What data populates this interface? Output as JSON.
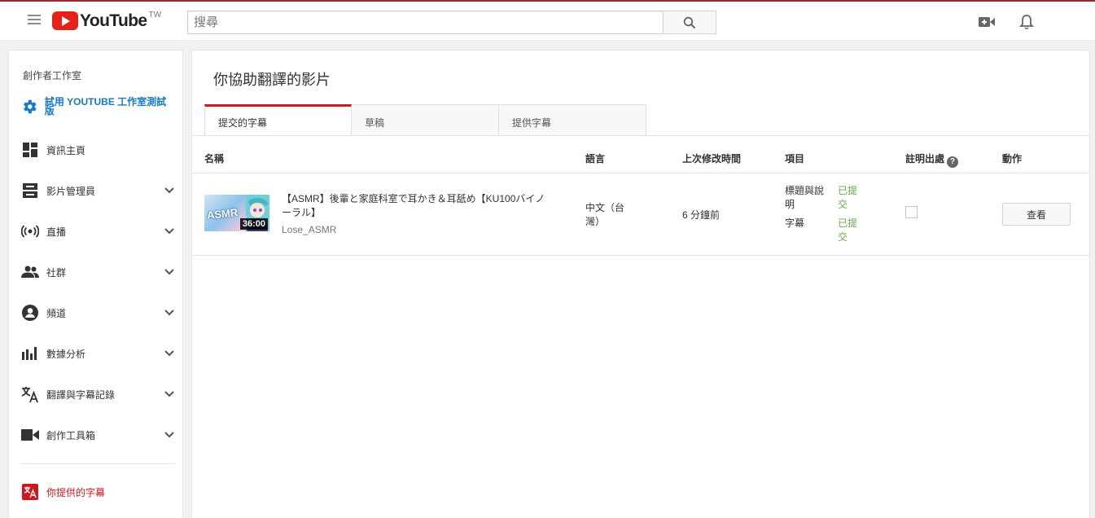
{
  "header": {
    "logo_text": "YouTube",
    "logo_region": "TW",
    "search_placeholder": "搜尋"
  },
  "sidebar": {
    "header": "創作者工作室",
    "try_studio": "試用 YOUTUBE 工作室測試版",
    "items": [
      {
        "label": "資訊主頁",
        "icon": "dashboard-icon"
      },
      {
        "label": "影片管理員",
        "icon": "video-manager-icon"
      },
      {
        "label": "直播",
        "icon": "live-icon"
      },
      {
        "label": "社群",
        "icon": "community-icon"
      },
      {
        "label": "頻道",
        "icon": "channel-icon"
      },
      {
        "label": "數據分析",
        "icon": "analytics-icon"
      },
      {
        "label": "翻譯與字幕記錄",
        "icon": "translate-icon"
      },
      {
        "label": "創作工具箱",
        "icon": "create-icon"
      }
    ],
    "contributions": "你提供的字幕"
  },
  "main": {
    "title": "你協助翻譯的影片",
    "tabs": [
      {
        "label": "提交的字幕",
        "active": true
      },
      {
        "label": "草稿",
        "active": false
      },
      {
        "label": "提供字幕",
        "active": false
      }
    ],
    "columns": {
      "name": "名稱",
      "language": "語言",
      "modified": "上次修改時間",
      "items": "項目",
      "credit": "註明出處",
      "action": "動作"
    },
    "rows": [
      {
        "thumb_text": "ASMR",
        "duration": "36:00",
        "title": "【ASMR】後輩と家庭科室で耳かき＆耳舐め【KU100バイノーラル】",
        "channel": "Lose_ASMR",
        "language": "中文（台灣）",
        "modified": "6 分鐘前",
        "item1_label": "標題與說明",
        "item1_status": "已提交",
        "item2_label": "字幕",
        "item2_status": "已提交",
        "credit_checked": false,
        "action_label": "查看"
      }
    ]
  },
  "colors": {
    "accent_red": "#cc181e",
    "link_blue": "#167ac6",
    "status_green": "#6aa84f"
  }
}
